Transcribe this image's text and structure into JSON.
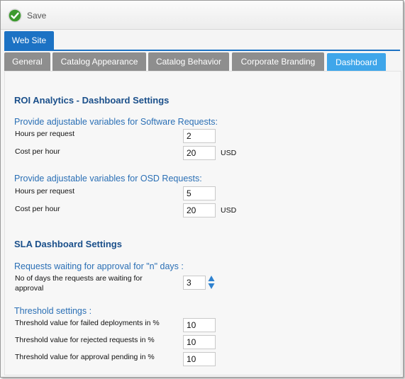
{
  "toolbar": {
    "save_label": "Save"
  },
  "site_tab": "Web Site",
  "tabs": [
    "General",
    "Catalog Appearance",
    "Catalog Behavior",
    "Corporate Branding",
    "Dashboard"
  ],
  "active_tab": "Dashboard",
  "roi": {
    "title": "ROI Analytics - Dashboard Settings",
    "software": {
      "heading": "Provide adjustable variables for Software Requests:",
      "hours_label": "Hours per request",
      "hours_value": "2",
      "cost_label": "Cost per hour",
      "cost_value": "20",
      "unit": "USD"
    },
    "osd": {
      "heading": "Provide adjustable variables for OSD Requests:",
      "hours_label": "Hours per request",
      "hours_value": "5",
      "cost_label": "Cost per hour",
      "cost_value": "20",
      "unit": "USD"
    }
  },
  "sla": {
    "title": "SLA Dashboard Settings",
    "waiting": {
      "heading": "Requests waiting for approval for \"n\" days :",
      "label_line1": "No of days the requests are waiting for",
      "label_line2": "approval",
      "value": "3"
    },
    "threshold": {
      "heading": "Threshold settings :",
      "failed_label": "Threshold value for failed deployments in %",
      "failed_value": "10",
      "rejected_label": "Threshold value for rejected requests in %",
      "rejected_value": "10",
      "pending_label": "Threshold value for approval pending in %",
      "pending_value": "10"
    }
  },
  "colors": {
    "accent": "#1c72c4",
    "active_tab": "#3fa6ea",
    "inactive_tab": "#8e8e8e",
    "heading": "#1a4f8a",
    "subheading": "#2a6fb5"
  },
  "icons": {
    "save": "check-circle-icon",
    "spinner": "up-down-arrows-icon"
  }
}
